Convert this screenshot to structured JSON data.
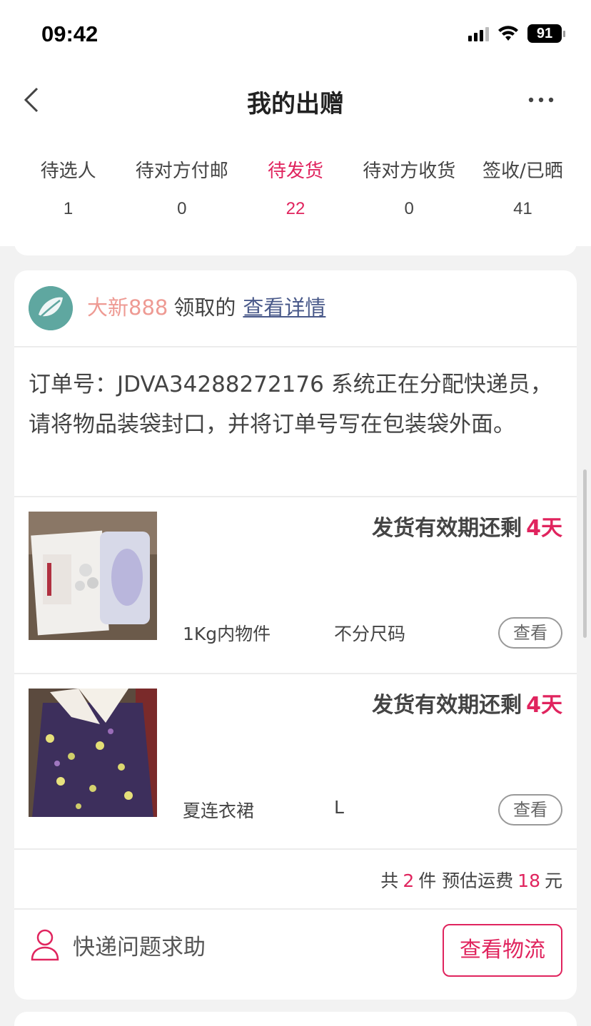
{
  "status_bar": {
    "time": "09:42",
    "battery": "91"
  },
  "nav": {
    "title": "我的出赠"
  },
  "tabs": [
    {
      "label": "待选人",
      "count": "1"
    },
    {
      "label": "待对方付邮",
      "count": "0"
    },
    {
      "label": "待发货",
      "count": "22",
      "active": true
    },
    {
      "label": "待对方收货",
      "count": "0"
    },
    {
      "label": "签收/已晒",
      "count": "41"
    }
  ],
  "card": {
    "user": "大新888",
    "claim_text": "领取的",
    "detail_link": "查看详情",
    "order_notice": "订单号：JDVA34288272176 系统正在分配快递员，请将物品装袋封口，并将订单号写在包装袋外面。",
    "items": [
      {
        "deadline_label": "发货有效期还剩",
        "deadline_days": "4天",
        "name": "1Kg内物件",
        "size": "不分尺码",
        "view_label": "查看",
        "image": "boxed-device-photo"
      },
      {
        "deadline_label": "发货有效期还剩",
        "deadline_days": "4天",
        "name": "夏连衣裙",
        "size": "L",
        "view_label": "查看",
        "image": "floral-dress-photo"
      }
    ],
    "summary": {
      "prefix": "共",
      "count": "2",
      "unit": "件 预估运费",
      "fee": "18",
      "currency": "元"
    },
    "help_label": "快递问题求助",
    "logistics_label": "查看物流"
  },
  "colors": {
    "accent": "#e0245e",
    "username": "#ee9a93",
    "link": "#4a5a8a"
  }
}
